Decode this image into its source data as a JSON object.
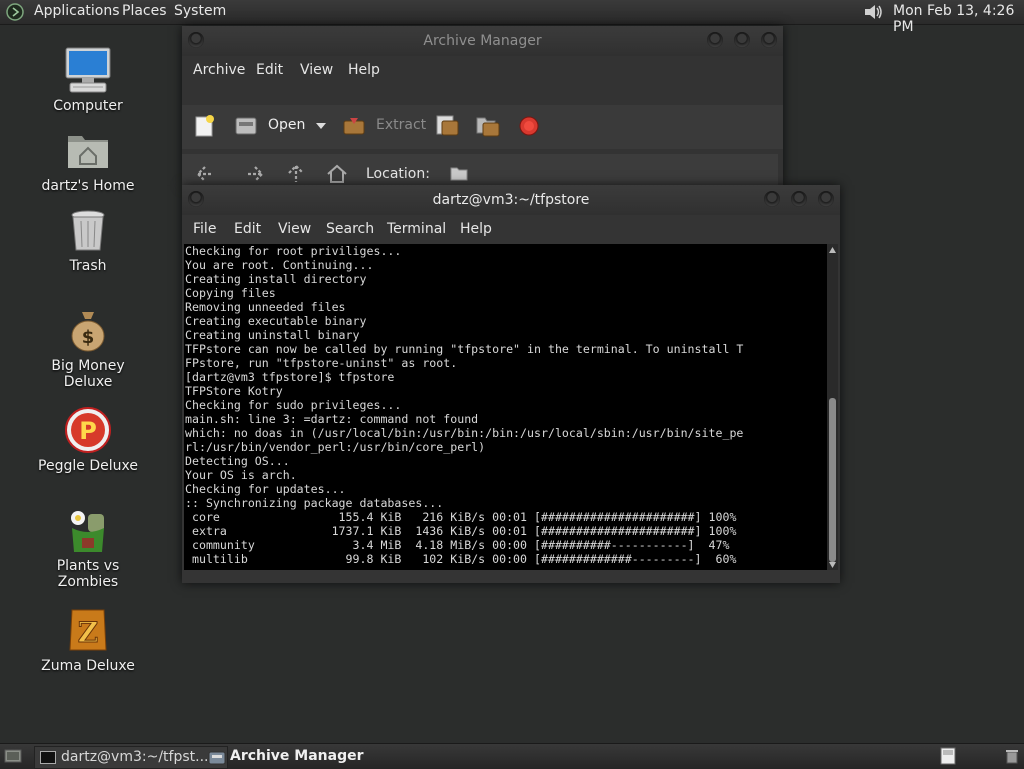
{
  "top_panel": {
    "menus": [
      "Applications",
      "Places",
      "System"
    ],
    "clock": "Mon Feb 13,  4:26 PM"
  },
  "desktop_icons": [
    {
      "label": "Computer",
      "icon": "computer-icon"
    },
    {
      "label": "dartz's Home",
      "icon": "home-folder-icon"
    },
    {
      "label": "Trash",
      "icon": "trash-icon"
    },
    {
      "label": "Big Money Deluxe",
      "icon": "money-bag-icon"
    },
    {
      "label": "Peggle Deluxe",
      "icon": "peggle-icon"
    },
    {
      "label": "Plants vs Zombies",
      "icon": "plants-vs-zombies-icon"
    },
    {
      "label": "Zuma Deluxe",
      "icon": "zuma-icon"
    }
  ],
  "archive_manager": {
    "title": "Archive Manager",
    "menu": [
      "Archive",
      "Edit",
      "View",
      "Help"
    ],
    "toolbar": {
      "open": "Open",
      "extract": "Extract"
    },
    "location_label": "Location:"
  },
  "terminal": {
    "title": "dartz@vm3:~/tfpstore",
    "menu": [
      "File",
      "Edit",
      "View",
      "Search",
      "Terminal",
      "Help"
    ],
    "lines": [
      "Checking for root priviliges...",
      "You are root. Continuing...",
      "Creating install directory",
      "Copying files",
      "Removing unneeded files",
      "Creating executable binary",
      "Creating uninstall binary",
      "TFPstore can now be called by running \"tfpstore\" in the terminal. To uninstall T",
      "FPstore, run \"tfpstore-uninst\" as root.",
      "[dartz@vm3 tfpstore]$ tfpstore",
      "TFPStore Kotry",
      "Checking for sudo privileges...",
      "main.sh: line 3: =dartz: command not found",
      "which: no doas in (/usr/local/bin:/usr/bin:/bin:/usr/local/sbin:/usr/bin/site_pe",
      "rl:/usr/bin/vendor_perl:/usr/bin/core_perl)",
      "Detecting OS...",
      "Your OS is arch.",
      "Checking for updates...",
      ":: Synchronizing package databases...",
      " core                 155.4 KiB   216 KiB/s 00:01 [######################] 100%",
      " extra               1737.1 KiB  1436 KiB/s 00:01 [######################] 100%",
      " community              3.4 MiB  4.18 MiB/s 00:00 [##########-----------]  47%",
      " multilib              99.8 KiB   102 KiB/s 00:00 [#############---------]  60%"
    ]
  },
  "taskbar": {
    "tasks": [
      "dartz@vm3:~/tfpst...",
      "Archive Manager"
    ]
  },
  "colors": {
    "desktop": "#2b2d2c",
    "panel": "#303030",
    "terminal_bg": "#000000",
    "terminal_fg": "#d8d8d8"
  }
}
